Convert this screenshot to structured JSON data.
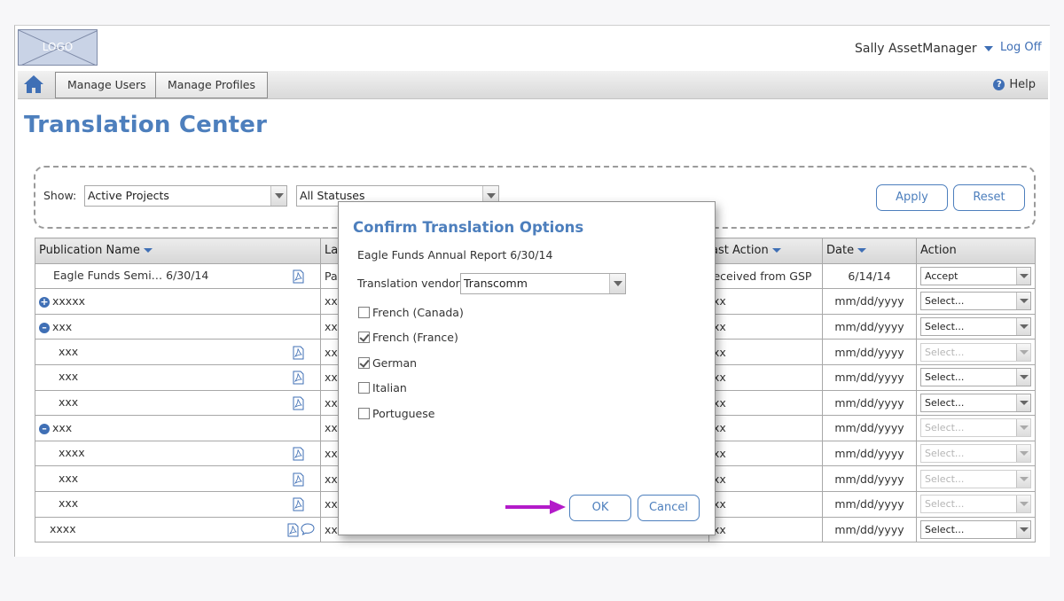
{
  "header": {
    "logo_text": "LOGO",
    "user_name": "Sally AssetManager",
    "logoff_label": "Log Off",
    "help_label": "Help"
  },
  "nav": {
    "tabs": [
      {
        "label": "Manage Users"
      },
      {
        "label": "Manage Profiles"
      }
    ]
  },
  "page": {
    "title": "Translation Center"
  },
  "filters": {
    "show_label": "Show:",
    "show_value": "Active Projects",
    "status_value": "All Statuses",
    "apply_label": "Apply",
    "reset_label": "Reset"
  },
  "table": {
    "columns": [
      "Publication Name",
      "La",
      "ast Action",
      "Date",
      "Action"
    ],
    "rows": [
      {
        "name": "Eagle Funds Semi… 6/30/14",
        "lang": "Pa",
        "last_action": "leceived from GSP",
        "date": "6/14/14",
        "action": "Accept"
      },
      {
        "name": "xxxxx",
        "lang": "xx",
        "last_action": "xx",
        "date": "mm/dd/yyyy",
        "action": "Select..."
      },
      {
        "name": "xxx",
        "lang": "xx",
        "last_action": "xx",
        "date": "mm/dd/yyyy",
        "action": "Select..."
      },
      {
        "name": "xxx",
        "lang": "xx",
        "last_action": "xx",
        "date": "mm/dd/yyyy",
        "action": "Select..."
      },
      {
        "name": "xxx",
        "lang": "xx",
        "last_action": "xx",
        "date": "mm/dd/yyyy",
        "action": "Select..."
      },
      {
        "name": "xxx",
        "lang": "xx",
        "last_action": "xx",
        "date": "mm/dd/yyyy",
        "action": "Select..."
      },
      {
        "name": "xxx",
        "lang": "xx",
        "last_action": "xx",
        "date": "mm/dd/yyyy",
        "action": "Select..."
      },
      {
        "name": "xxxx",
        "lang": "xx",
        "last_action": "xx",
        "date": "mm/dd/yyyy",
        "action": "Select..."
      },
      {
        "name": "xxx",
        "lang": "xx",
        "last_action": "xx",
        "date": "mm/dd/yyyy",
        "action": "Select..."
      },
      {
        "name": "xxx",
        "lang": "xx",
        "last_action": "xx",
        "date": "mm/dd/yyyy",
        "action": "Select..."
      },
      {
        "name": "xxxx",
        "lang": "xx",
        "last_action": "xx",
        "date": "mm/dd/yyyy",
        "action": "Select..."
      }
    ]
  },
  "dialog": {
    "title": "Confirm Translation Options",
    "subtitle": "Eagle Funds Annual Report 6/30/14",
    "vendor_label": "Translation vendor:",
    "vendor_value": "Transcomm",
    "languages": [
      {
        "label": "French (Canada)",
        "checked": false
      },
      {
        "label": "French (France)",
        "checked": true
      },
      {
        "label": "German",
        "checked": true
      },
      {
        "label": "Italian",
        "checked": false
      },
      {
        "label": "Portuguese",
        "checked": false
      }
    ],
    "ok_label": "OK",
    "cancel_label": "Cancel"
  },
  "colors": {
    "accent": "#4d7fbd",
    "annotation_arrow": "#b31bc9"
  }
}
